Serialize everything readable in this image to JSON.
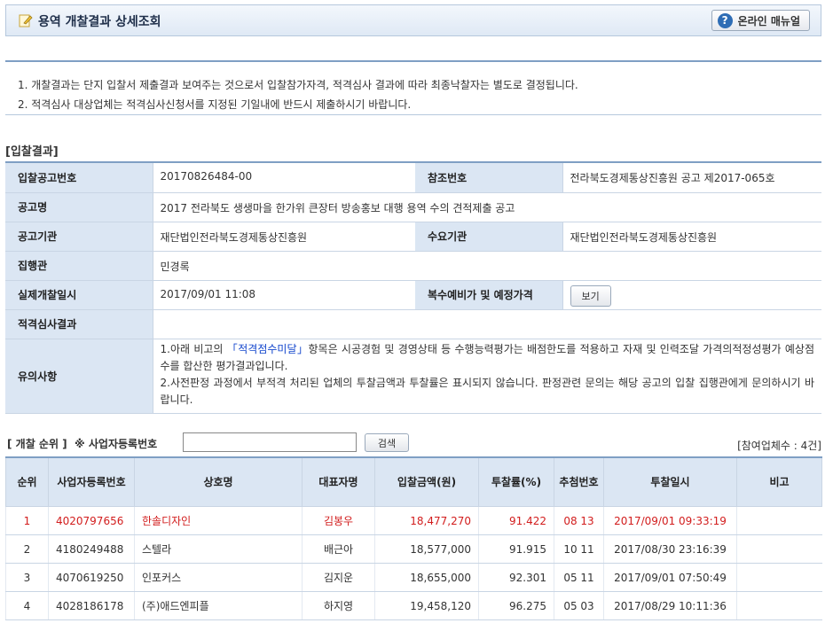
{
  "header": {
    "title": "용역 개찰결과 상세조회",
    "manual_label": "온라인 매뉴얼"
  },
  "notices": [
    "1.  개찰결과는 단지 입찰서 제출결과 보여주는 것으로서 입찰참가자격, 적격심사 결과에 따라 최종낙찰자는 별도로 결정됩니다.",
    "2.  적격심사 대상업체는 적격심사신청서를 지정된 기일내에 반드시 제출하시기 바랍니다."
  ],
  "bid_section_label": "[입찰결과]",
  "detail": {
    "notice_no_label": "입찰공고번호",
    "notice_no": "20170826484-00",
    "ref_no_label": "참조번호",
    "ref_no": "전라북도경제통상진흥원 공고 제2017-065호",
    "notice_name_label": "공고명",
    "notice_name": "2017 전라북도 생생마을 한가위 큰장터 방송홍보 대행 용역 수의 견적제출 공고",
    "agency_label": "공고기관",
    "agency": "재단법인전라북도경제통상진흥원",
    "demand_label": "수요기관",
    "demand": "재단법인전라북도경제통상진흥원",
    "officer_label": "집행관",
    "officer": "민경록",
    "open_date_label": "실제개찰일시",
    "open_date": "2017/09/01 11:08",
    "price_label": "복수예비가 및 예정가격",
    "view_button": "보기",
    "qual_label": "적격심사결과",
    "qual_value": "",
    "remarks_label": "유의사항",
    "remark1_a": "1.아래 비고의 ",
    "remark1_link": "「적격점수미달」",
    "remark1_b": "항목은 시공경험 및 경영상태 등 수행능력평가는 배점한도를 적용하고 자재 및 인력조달 가격의적정성평가 예상점수를 합산한 평가결과입니다.",
    "remark2": "2.사전판정 과정에서 부적격 처리된 업체의 투찰금액과 투찰률은 표시되지 않습니다. 판정관련 문의는 해당 공고의 입찰 집행관에게 문의하시기 바랍니다."
  },
  "ranking": {
    "label": "[ 개찰 순위 ]",
    "search_label": "※ 사업자등록번호",
    "search_value": "",
    "search_button": "검색",
    "participant_count": "[참여업체수 : 4건]",
    "columns": [
      "순위",
      "사업자등록번호",
      "상호명",
      "대표자명",
      "입찰금액(원)",
      "투찰률(%)",
      "추첨번호",
      "투찰일시",
      "비고"
    ],
    "rows": [
      {
        "rank": "1",
        "biz_no": "4020797656",
        "company": "한솔디자인",
        "ceo": "김봉우",
        "amount": "18,477,270",
        "rate": "91.422",
        "draw": "08 13",
        "date": "2017/09/01 09:33:19",
        "note": ""
      },
      {
        "rank": "2",
        "biz_no": "4180249488",
        "company": "스텔라",
        "ceo": "배근아",
        "amount": "18,577,000",
        "rate": "91.915",
        "draw": "10 11",
        "date": "2017/08/30 23:16:39",
        "note": ""
      },
      {
        "rank": "3",
        "biz_no": "4070619250",
        "company": "인포커스",
        "ceo": "김지운",
        "amount": "18,655,000",
        "rate": "92.301",
        "draw": "05 11",
        "date": "2017/09/01 07:50:49",
        "note": ""
      },
      {
        "rank": "4",
        "biz_no": "4028186178",
        "company": "(주)애드엔피플",
        "ceo": "하지영",
        "amount": "19,458,120",
        "rate": "96.275",
        "draw": "05 03",
        "date": "2017/08/29 10:11:36",
        "note": ""
      }
    ]
  }
}
